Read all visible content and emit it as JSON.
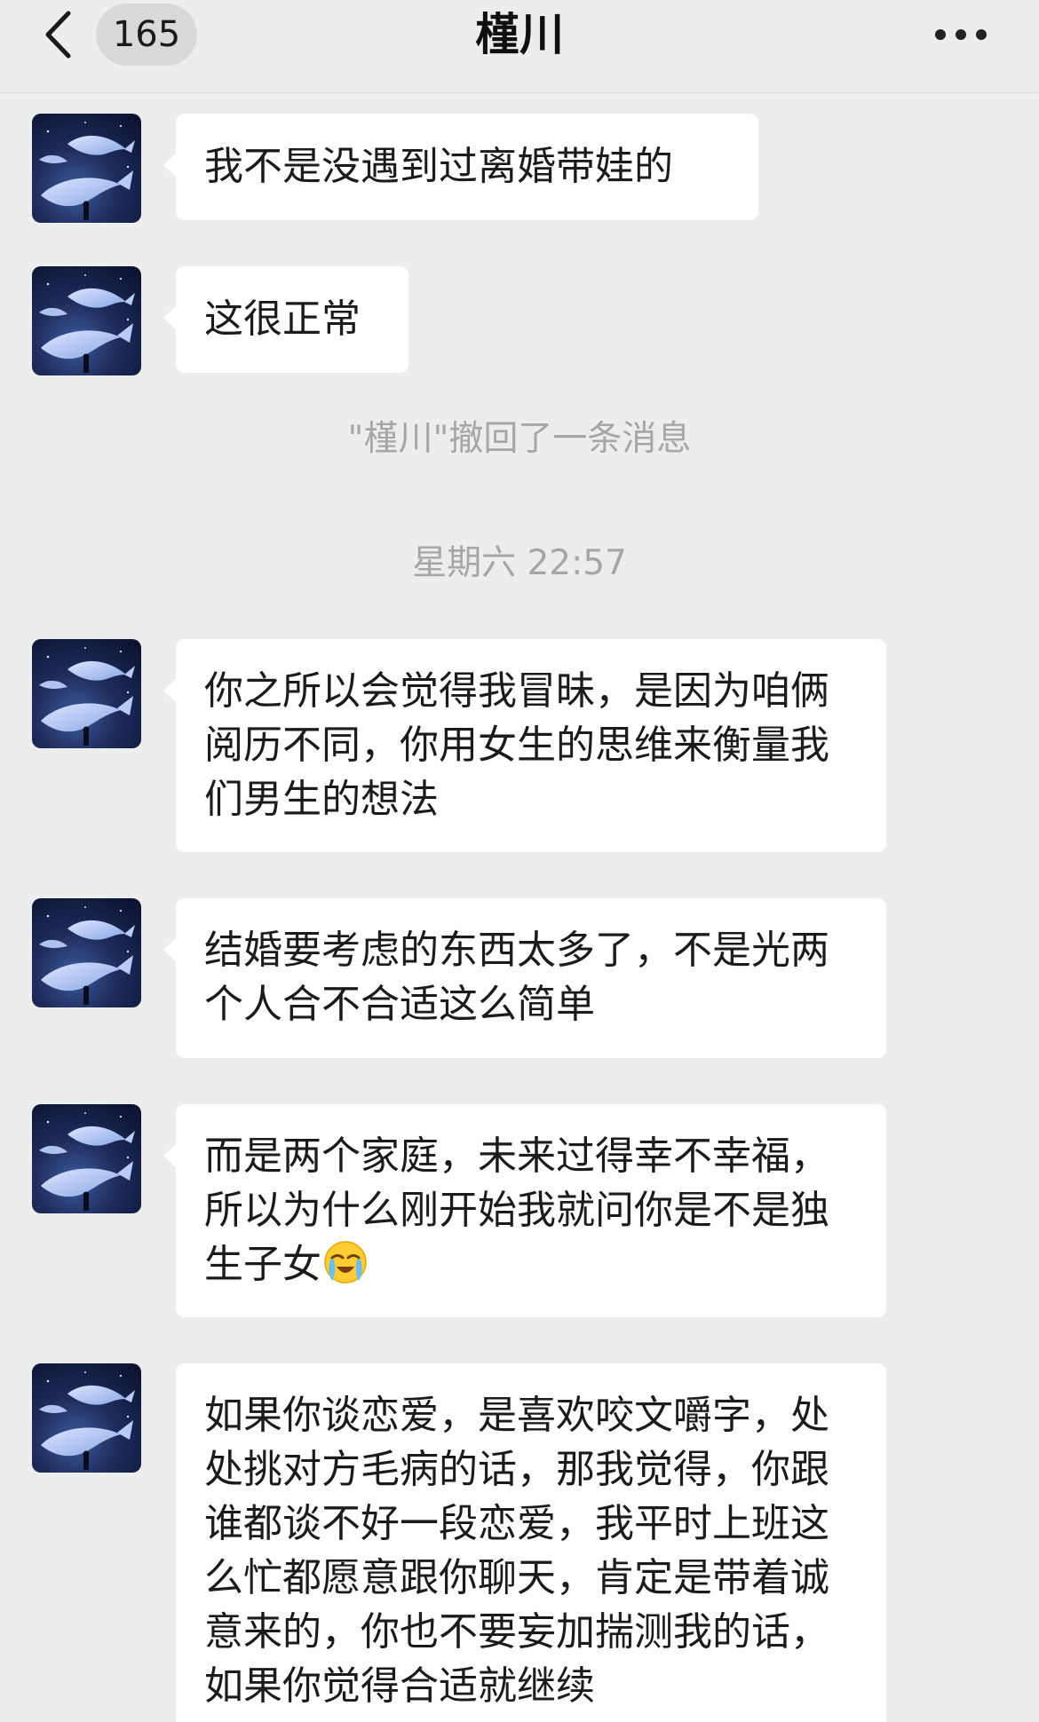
{
  "header": {
    "back_icon": "chevron-left-icon",
    "unread_count": "165",
    "title": "槿川",
    "more_icon": "more-dots-icon"
  },
  "messages": [
    {
      "text": "我不是没遇到过离婚带娃的"
    },
    {
      "text": "这很正常"
    },
    {
      "text": "你之所以会觉得我冒昧，是因为咱俩阅历不同，你用女生的思维来衡量我们男生的想法"
    },
    {
      "text": "结婚要考虑的东西太多了，不是光两个人合不合适这么简单"
    },
    {
      "text": "而是两个家庭，未来过得幸不幸福，所以为什么刚开始我就问你是不是独生子女",
      "emoji": "loudly-crying-face"
    },
    {
      "text": "如果你谈恋爱，是喜欢咬文嚼字，处处挑对方毛病的话，那我觉得，你跟谁都谈不好一段恋爱，我平时上班这么忙都愿意跟你聊天，肯定是带着诚意来的，你也不要妄加揣测我的话，如果你觉得合适就继续"
    }
  ],
  "system": {
    "recall_notice": "\"槿川\"撤回了一条消息",
    "timestamp": "星期六 22:57"
  },
  "colors": {
    "background": "#ededed",
    "bubble": "#ffffff",
    "system_text": "#a6a6a6"
  }
}
